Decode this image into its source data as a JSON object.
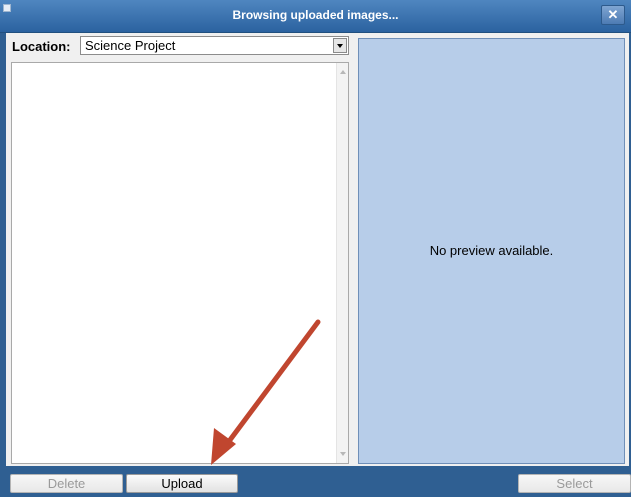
{
  "window": {
    "title": "Browsing uploaded images...",
    "close_label": "✕"
  },
  "location": {
    "label": "Location:",
    "selected": "Science Project"
  },
  "preview": {
    "message": "No preview available."
  },
  "buttons": {
    "delete": "Delete",
    "upload": "Upload",
    "select": "Select"
  },
  "colors": {
    "titlebar": "#2b62a0",
    "frame": "#2f5f92",
    "preview_bg": "#b7cde9",
    "annotation_arrow": "#c0462f"
  }
}
